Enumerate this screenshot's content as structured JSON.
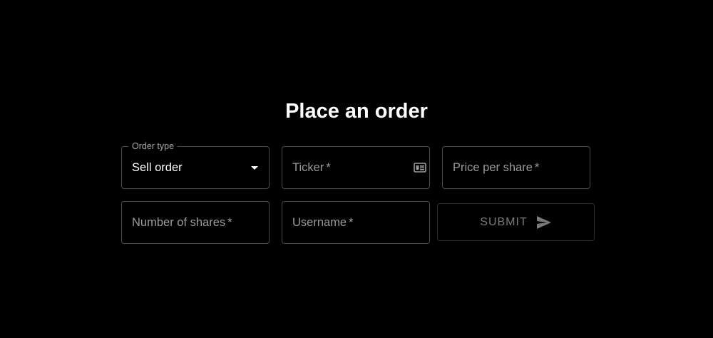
{
  "page": {
    "title": "Place an order"
  },
  "form": {
    "order_type": {
      "legend": "Order type",
      "value": "Sell order",
      "icon": "chevron-down-icon"
    },
    "ticker": {
      "placeholder": "Ticker",
      "required_marker": "*",
      "icon": "contact-card-icon"
    },
    "price_per_share": {
      "placeholder": "Price per share",
      "required_marker": "*"
    },
    "number_of_shares": {
      "placeholder": "Number of shares",
      "required_marker": "*"
    },
    "username": {
      "placeholder": "Username",
      "required_marker": "*"
    },
    "submit": {
      "label": "SUBMIT",
      "icon": "send-icon"
    }
  },
  "colors": {
    "background": "#000000",
    "text": "#ffffff",
    "placeholder": "#9a9a9a",
    "border": "#4a4a4a",
    "disabled_text": "#7a7a7a"
  }
}
